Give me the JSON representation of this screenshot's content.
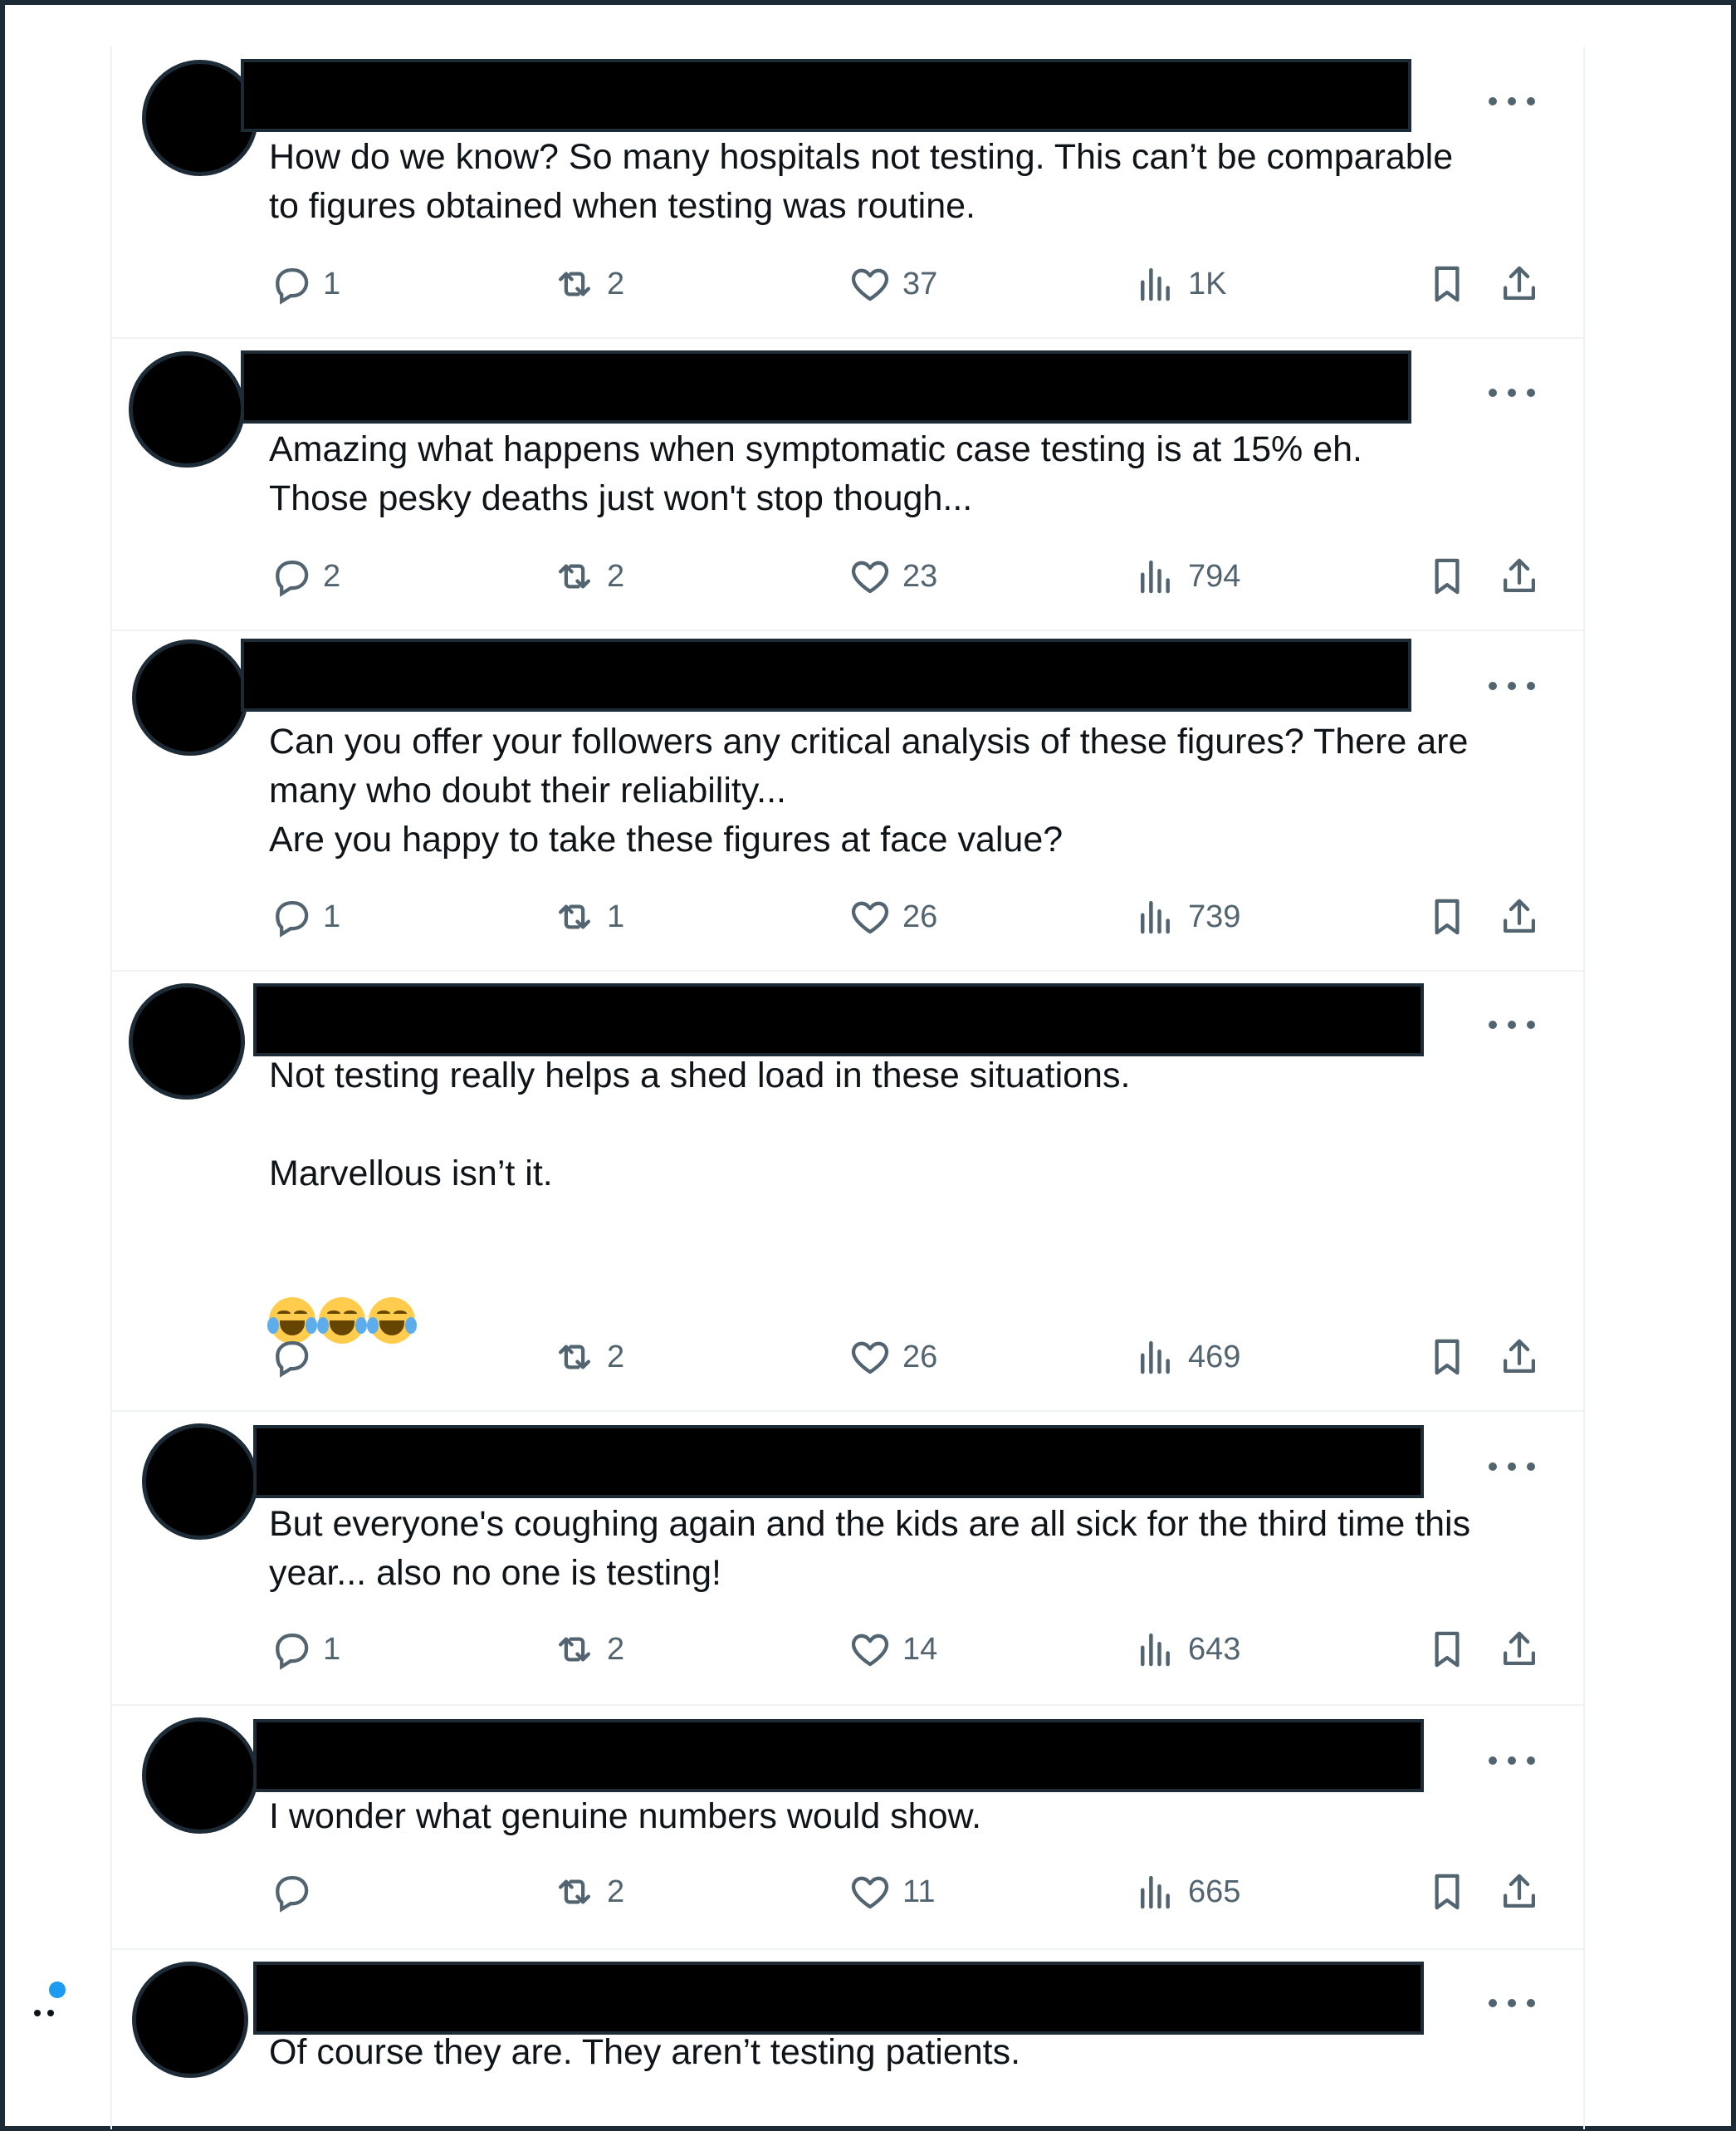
{
  "replies": [
    {
      "text": "How do we know? So many hospitals not testing. This can’t be comparable\nto figures obtained when testing was routine.",
      "reply_count": "1",
      "retweet_count": "2",
      "like_count": "37",
      "view_count": "1K"
    },
    {
      "text": "Amazing what happens when symptomatic case testing is at 15% eh.\nThose pesky deaths just won't stop though...",
      "reply_count": "2",
      "retweet_count": "2",
      "like_count": "23",
      "view_count": "794"
    },
    {
      "text": "Can you offer your followers any critical analysis of these figures? There are\nmany who doubt their reliability...\nAre you happy to take these figures at face value?",
      "reply_count": "1",
      "retweet_count": "1",
      "like_count": "26",
      "view_count": "739"
    },
    {
      "text": "Not testing really helps a shed load in these situations.\n\nMarvellous isn’t it.",
      "emoji": [
        "face-with-tears-of-joy",
        "face-with-tears-of-joy",
        "face-with-tears-of-joy"
      ],
      "reply_count": "",
      "retweet_count": "2",
      "like_count": "26",
      "view_count": "469"
    },
    {
      "text": "But everyone's coughing again and the kids are all sick for the third time this\nyear... also no one is testing!",
      "reply_count": "1",
      "retweet_count": "2",
      "like_count": "14",
      "view_count": "643"
    },
    {
      "text": "I wonder what genuine numbers would show.",
      "reply_count": "",
      "retweet_count": "2",
      "like_count": "11",
      "view_count": "665"
    },
    {
      "text": "Of course they are. They aren’t testing patients."
    }
  ],
  "icons": {
    "reply": "reply-icon",
    "retweet": "retweet-icon",
    "like": "heart-icon",
    "views": "analytics-icon",
    "bookmark": "bookmark-icon",
    "share": "share-icon",
    "more": "more-horizontal-icon"
  },
  "colors": {
    "text": "#0f1419",
    "secondary": "#536471",
    "divider": "#eff3f4",
    "accent": "#1d9bf0",
    "frame": "#1c2b36"
  }
}
